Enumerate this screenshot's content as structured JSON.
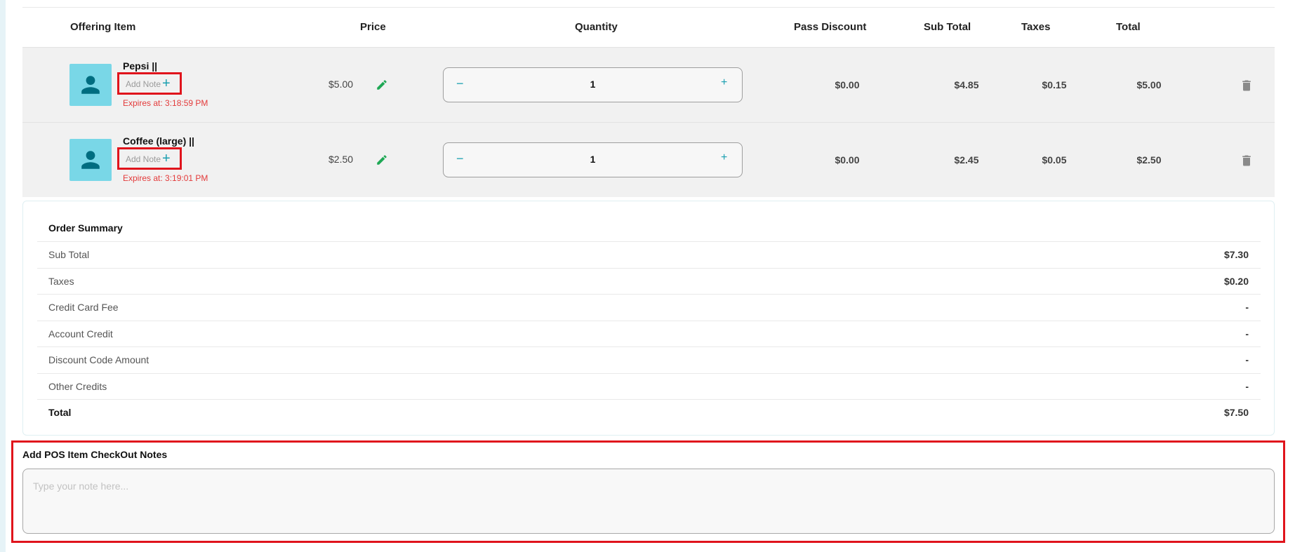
{
  "table": {
    "headers": {
      "item": "Offering Item",
      "price": "Price",
      "quantity": "Quantity",
      "pass_discount": "Pass Discount",
      "sub_total": "Sub Total",
      "taxes": "Taxes",
      "total": "Total"
    },
    "rows": [
      {
        "name": "Pepsi ||",
        "note_placeholder": "Add Note",
        "note_add_symbol": "+",
        "expires": "Expires at: 3:18:59 PM",
        "price": "$5.00",
        "quantity": "1",
        "qty_minus": "−",
        "qty_plus": "+",
        "pass_discount": "$0.00",
        "sub_total": "$4.85",
        "taxes": "$0.15",
        "total": "$5.00"
      },
      {
        "name": "Coffee (large) ||",
        "note_placeholder": "Add Note",
        "note_add_symbol": "+",
        "expires": "Expires at: 3:19:01 PM",
        "price": "$2.50",
        "quantity": "1",
        "qty_minus": "−",
        "qty_plus": "+",
        "pass_discount": "$0.00",
        "sub_total": "$2.45",
        "taxes": "$0.05",
        "total": "$2.50"
      }
    ]
  },
  "summary": {
    "title": "Order Summary",
    "lines": [
      {
        "label": "Sub Total",
        "value": "$7.30"
      },
      {
        "label": "Taxes",
        "value": "$0.20"
      },
      {
        "label": "Credit Card Fee",
        "value": "-"
      },
      {
        "label": "Account Credit",
        "value": "-"
      },
      {
        "label": "Discount Code Amount",
        "value": "-"
      },
      {
        "label": "Other Credits",
        "value": "-"
      },
      {
        "label": "Total",
        "value": "$7.50"
      }
    ]
  },
  "notes": {
    "label": "Add POS Item CheckOut Notes",
    "placeholder": "Type your note here..."
  },
  "colors": {
    "accent": "#1a9fb0",
    "avatar_bg": "#79d7e7",
    "avatar_icon": "#006d80",
    "edit_icon": "#1fa855",
    "expires_text": "#e33a3a",
    "highlight_border": "#e0141c"
  },
  "icons": {
    "avatar": "person-icon",
    "edit": "pencil-icon",
    "delete": "trash-icon"
  }
}
